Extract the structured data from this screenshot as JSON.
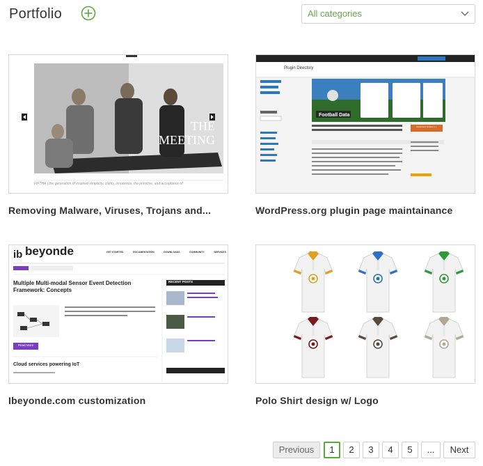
{
  "header": {
    "title": "Portfolio",
    "add_icon": "plus-circle-icon",
    "category_select": {
      "value": "All categories"
    }
  },
  "items": [
    {
      "title": "Removing Malware, Viruses, Trojans and...",
      "thumb": {
        "headline": "THE MEETING",
        "caption": "FIFTHA | the generation of inspired simplicity, clarity, innocence, the primitive, and acceptance of"
      }
    },
    {
      "title": "WordPress.org plugin page maintainance",
      "thumb": {
        "header": "Plugin Directory",
        "banner": "Football Data",
        "download": "Download Version 1.1"
      }
    },
    {
      "title": "Ibeyonde.com customization",
      "thumb": {
        "logo": "beyonde",
        "nav": [
          "GET STARTED",
          "DOCUMENTATION",
          "DOWNLOADS",
          "COMMUNITY",
          "SERVICES"
        ],
        "post_title": "Multiple Multi-modal Sensor Event Detection Framework: Concepts",
        "read_more": "Read More",
        "post2": "Cloud services powering IoT",
        "recent": "RECENT POSTS"
      }
    },
    {
      "title": "Polo Shirt design w/ Logo",
      "thumb": {
        "shirt_colors": [
          "#e0a020",
          "#2a70c8",
          "#2e9a3a",
          "#7a1a1a",
          "#5a4a3a",
          "#b0a890"
        ]
      }
    }
  ],
  "pagination": {
    "previous": "Previous",
    "pages": [
      "1",
      "2",
      "3",
      "4",
      "5"
    ],
    "ellipsis": "...",
    "next": "Next",
    "current": "1"
  },
  "colors": {
    "accent_green": "#58a83d",
    "select_text": "#6aa84f"
  }
}
